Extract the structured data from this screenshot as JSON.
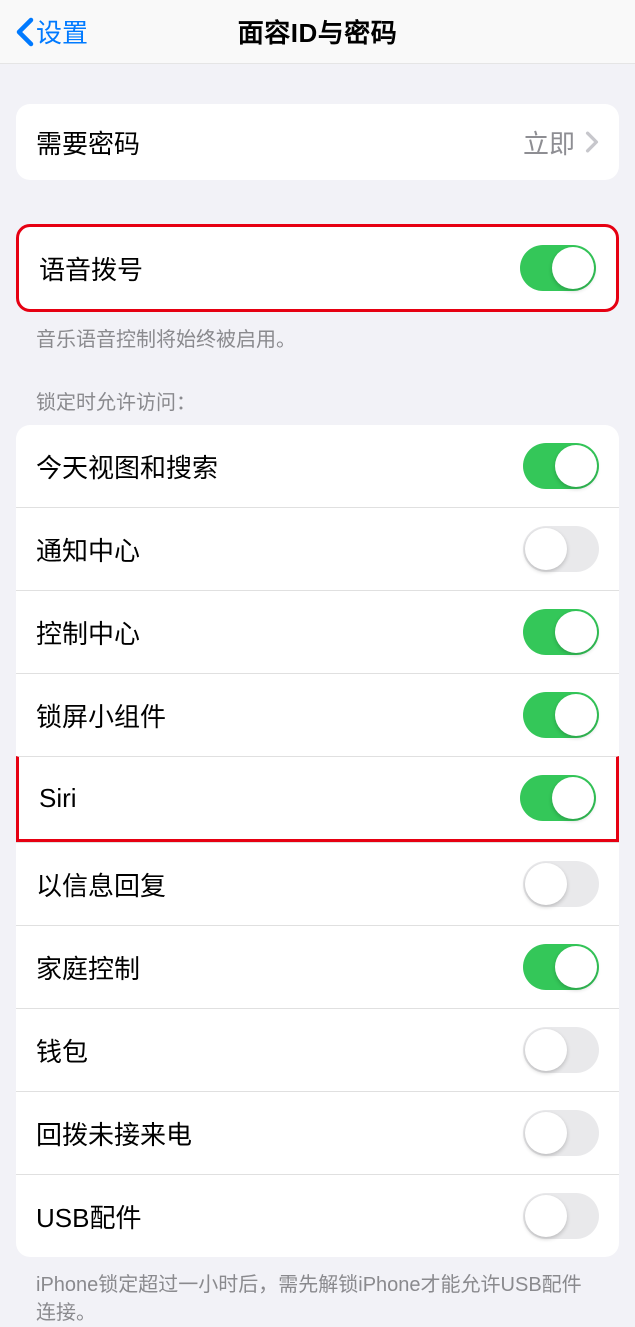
{
  "nav": {
    "back_label": "设置",
    "title": "面容ID与密码"
  },
  "passcode_group": {
    "require_label": "需要密码",
    "require_value": "立即"
  },
  "voice_group": {
    "label": "语音拨号",
    "on": true,
    "footer": "音乐语音控制将始终被启用。"
  },
  "lock_group": {
    "header": "锁定时允许访问：",
    "items": [
      {
        "label": "今天视图和搜索",
        "on": true,
        "highlight": false
      },
      {
        "label": "通知中心",
        "on": false,
        "highlight": false
      },
      {
        "label": "控制中心",
        "on": true,
        "highlight": false
      },
      {
        "label": "锁屏小组件",
        "on": true,
        "highlight": false
      },
      {
        "label": "Siri",
        "on": true,
        "highlight": true
      },
      {
        "label": "以信息回复",
        "on": false,
        "highlight": false
      },
      {
        "label": "家庭控制",
        "on": true,
        "highlight": false
      },
      {
        "label": "钱包",
        "on": false,
        "highlight": false
      },
      {
        "label": "回拨未接来电",
        "on": false,
        "highlight": false
      },
      {
        "label": "USB配件",
        "on": false,
        "highlight": false
      }
    ],
    "footer": "iPhone锁定超过一小时后，需先解锁iPhone才能允许USB配件连接。"
  }
}
